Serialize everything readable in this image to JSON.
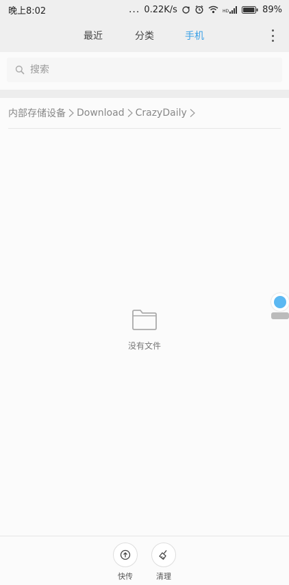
{
  "status_bar": {
    "time": "晚上8:02",
    "dots": "...",
    "net_speed": "0.22K/s",
    "signal_type": "HD",
    "battery": "89%",
    "icons": [
      "sync-icon",
      "alarm-icon",
      "wifi-icon",
      "signal-icon",
      "battery-icon"
    ]
  },
  "tabs": [
    {
      "label": "最近",
      "active": false
    },
    {
      "label": "分类",
      "active": false
    },
    {
      "label": "手机",
      "active": true
    }
  ],
  "accent_color": "#3aa0e6",
  "search": {
    "placeholder": "搜索",
    "value": ""
  },
  "breadcrumb": [
    "内部存储设备",
    "Download",
    "CrazyDaily"
  ],
  "empty_state": {
    "icon": "folder-icon",
    "text": "没有文件"
  },
  "floating_ball": {
    "color": "#5bb8f2"
  },
  "bottom_actions": [
    {
      "label": "快传",
      "icon": "upload-icon"
    },
    {
      "label": "清理",
      "icon": "broom-icon"
    }
  ]
}
